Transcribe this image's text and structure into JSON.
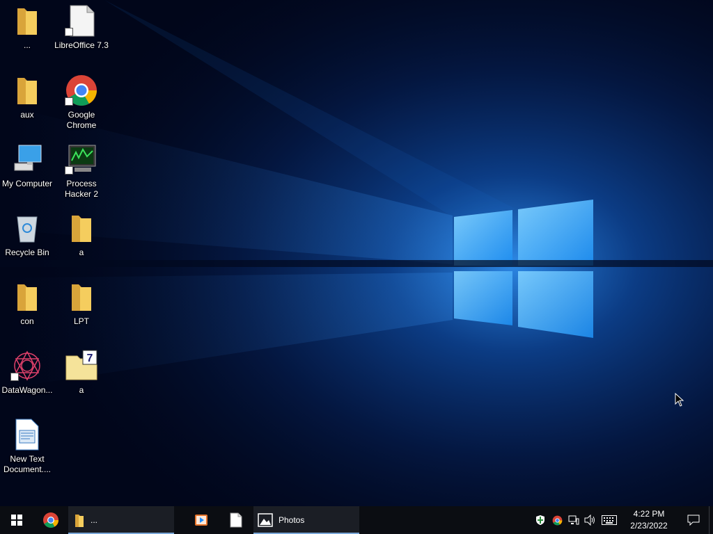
{
  "desktop": {
    "icons": [
      {
        "label": "...",
        "kind": "folder"
      },
      {
        "label": "LibreOffice 7.3",
        "kind": "libreoffice",
        "shortcut": true
      },
      {
        "label": "aux",
        "kind": "folder"
      },
      {
        "label": "Google Chrome",
        "kind": "chrome",
        "shortcut": true
      },
      {
        "label": "My Computer",
        "kind": "computer"
      },
      {
        "label": "Process Hacker 2",
        "kind": "process-hacker",
        "shortcut": true
      },
      {
        "label": "Recycle Bin",
        "kind": "recycle-bin"
      },
      {
        "label": "a",
        "kind": "folder"
      },
      {
        "label": "con",
        "kind": "folder"
      },
      {
        "label": "LPT",
        "kind": "folder"
      },
      {
        "label": "DataWagon...",
        "kind": "datawagon",
        "shortcut": true
      },
      {
        "label": "a",
        "kind": "7zip-archive"
      },
      {
        "label": "New Text Document....",
        "kind": "text-document"
      }
    ]
  },
  "taskbar": {
    "explorer_label": "...",
    "photos_label": "Photos",
    "clock_time": "4:22 PM",
    "clock_date": "2/23/2022"
  },
  "colors": {
    "taskbar_bg": "#0b0d12",
    "folder_yellow": "#f5cd5e",
    "accent_blue": "#1e8cff"
  }
}
